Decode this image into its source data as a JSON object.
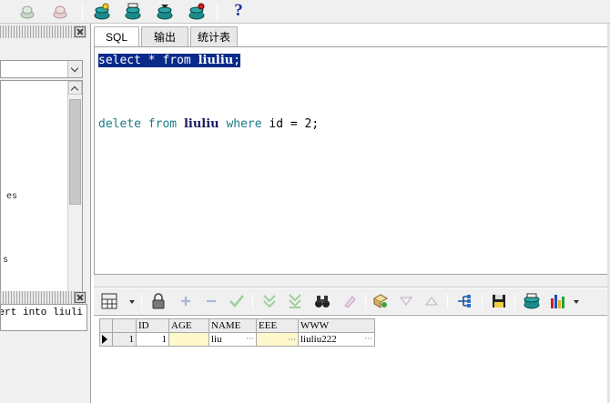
{
  "toolbar": {
    "icons": [
      "db-connect-icon",
      "db-disconnect-icon",
      "commit-icon",
      "rollback-icon",
      "plan-icon",
      "restore-icon"
    ],
    "help_label": "?"
  },
  "left_panel": {
    "tree_fragments": [
      "es",
      "s"
    ],
    "history_text": "ert into liuli"
  },
  "editor": {
    "tabs": [
      {
        "label": "SQL",
        "active": true
      },
      {
        "label": "输出",
        "active": false
      },
      {
        "label": "统计表",
        "active": false
      }
    ],
    "lines": {
      "line1": {
        "select": "select",
        "star": " * ",
        "from": "from",
        "table": "liuliu",
        "end": ";"
      },
      "line2": {
        "delete": "delete",
        "from": "from",
        "table": "liuliu",
        "where": "where",
        "cond": " id = 2;"
      }
    }
  },
  "grid": {
    "columns": [
      "ID",
      "AGE",
      "NAME",
      "EEE",
      "WWW"
    ],
    "rows": [
      {
        "rownum": "1",
        "ID": "1",
        "AGE": "",
        "NAME": "liu",
        "EEE": "",
        "WWW": "liuliu222"
      }
    ],
    "ellipsis": "···"
  },
  "colors": {
    "selection": "#0a2a8a",
    "keyword": "#1d7a85",
    "table_name": "#1a1a5e",
    "null_cell": "#fff8cc",
    "help": "#1d2f9a"
  }
}
